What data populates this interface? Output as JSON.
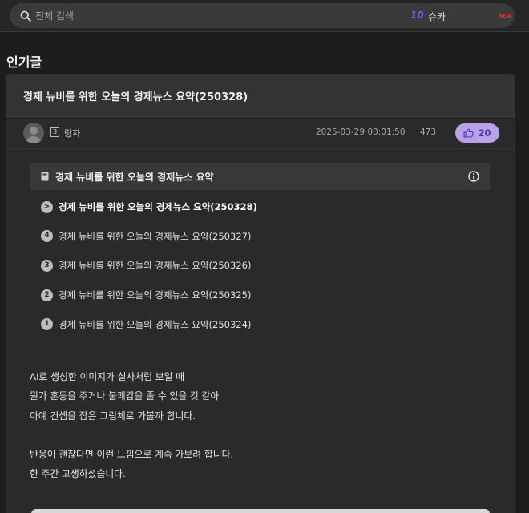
{
  "search": {
    "placeholder": "전체 검색",
    "trend_rank": "10",
    "trend_keyword": "슈카",
    "trend_badge": "NEW"
  },
  "section_title": "인기글",
  "post": {
    "title": "경제 뉴비를 위한 오늘의 경제뉴스 요약(250328)",
    "author_level": "3",
    "author": "랑자",
    "date": "2025-03-29 00:01:50",
    "views": "473",
    "likes": "20"
  },
  "series": {
    "title": "경제 뉴비를 위한 오늘의 경제뉴스 요약",
    "items": [
      {
        "num": ">",
        "label": "경제 뉴비를 위한 오늘의 경제뉴스 요약(250328)"
      },
      {
        "num": "4",
        "label": "경제 뉴비를 위한 오늘의 경제뉴스 요약(250327)"
      },
      {
        "num": "3",
        "label": "경제 뉴비를 위한 오늘의 경제뉴스 요약(250326)"
      },
      {
        "num": "2",
        "label": "경제 뉴비를 위한 오늘의 경제뉴스 요약(250325)"
      },
      {
        "num": "1",
        "label": "경제 뉴비를 위한 오늘의 경제뉴스 요약(250324)"
      }
    ]
  },
  "body": {
    "lines": [
      "AI로 생성한 이미지가 실사처럼 보일 때",
      "뭔가 혼동을 주거나 불쾌감을 줄 수 있을 것 같아",
      "아예 컨셉을 잡은 그림체로 가볼까 합니다.",
      "",
      "반응이 괜찮다면 이런 느낌으로 계속 가보려 합니다.",
      "한 주간 고생하셨습니다."
    ]
  },
  "colors": {
    "background": "#1d1d1d",
    "card": "#2a2a2a",
    "accent": "#7c5ed6",
    "like_bg": "#b9a2ea",
    "new_badge": "#d23a3a"
  }
}
